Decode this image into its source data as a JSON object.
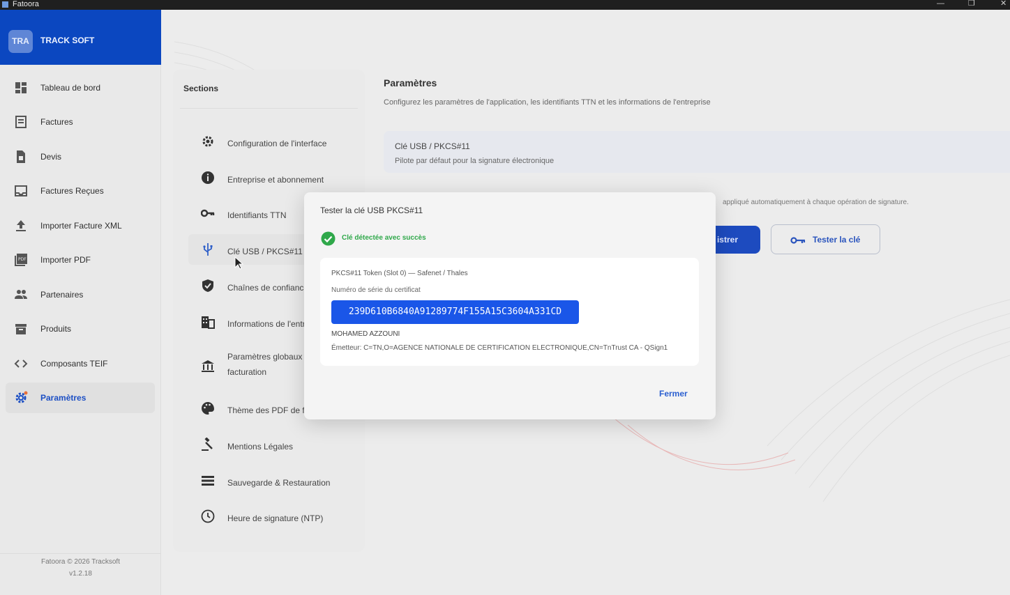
{
  "window": {
    "title": "Fatoora",
    "minimize": "—",
    "restore": "❐",
    "close": "✕"
  },
  "brand": {
    "logo": "TRA",
    "name": "TRACK SOFT"
  },
  "sidebar": {
    "items": [
      {
        "label": "Tableau de bord",
        "icon": "dashboard-icon"
      },
      {
        "label": "Factures",
        "icon": "invoice-icon"
      },
      {
        "label": "Devis",
        "icon": "quote-icon"
      },
      {
        "label": "Factures Reçues",
        "icon": "inbox-icon"
      },
      {
        "label": "Importer Facture XML",
        "icon": "upload-icon"
      },
      {
        "label": "Importer PDF",
        "icon": "pdf-icon"
      },
      {
        "label": "Partenaires",
        "icon": "people-icon"
      },
      {
        "label": "Produits",
        "icon": "box-icon"
      },
      {
        "label": "Composants TEIF",
        "icon": "code-icon"
      },
      {
        "label": "Paramètres",
        "icon": "gear-icon",
        "active": true
      }
    ],
    "footer_copyright": "Fatoora © 2026 Tracksoft",
    "footer_version": "v1.2.18"
  },
  "sections": {
    "heading": "Sections",
    "items": [
      {
        "label": "Configuration de l'interface",
        "icon": "gear-icon"
      },
      {
        "label": "Entreprise et abonnement",
        "icon": "info-icon"
      },
      {
        "label": "Identifiants TTN",
        "icon": "key-icon"
      },
      {
        "label": "Clé USB / PKCS#11",
        "icon": "usb-icon",
        "active": true
      },
      {
        "label": "Chaînes de confiance",
        "icon": "shield-icon"
      },
      {
        "label": "Informations de l'entreprise",
        "icon": "building-icon"
      },
      {
        "label": "Paramètres globaux de facturation",
        "icon": "bank-icon"
      },
      {
        "label": "Thème des PDF de facturation",
        "icon": "palette-icon"
      },
      {
        "label": "Mentions Légales",
        "icon": "gavel-icon"
      },
      {
        "label": "Sauvegarde & Restauration",
        "icon": "storage-icon"
      },
      {
        "label": "Heure de signature (NTP)",
        "icon": "clock-icon"
      }
    ]
  },
  "main": {
    "title": "Paramètres",
    "subtitle": "Configurez les paramètres de l'application, les identifiants TTN et les informations de l'entreprise",
    "usb_card_title": "Clé USB / PKCS#11",
    "usb_card_subtitle": "Pilote par défaut pour la signature électronique",
    "auto_note": "appliqué automatiquement à chaque opération de signature.",
    "save_button": "istrer",
    "test_button": "Tester la clé"
  },
  "modal": {
    "title": "Tester la clé USB PKCS#11",
    "success": "Clé détectée avec succès",
    "token": "PKCS#11 Token (Slot 0) — Safenet / Thales",
    "serial_label": "Numéro de série du certificat",
    "serial": "239D610B6840A91289774F155A15C3604A331CD",
    "holder": "MOHAMED AZZOUNI",
    "issuer": "Émetteur: C=TN,O=AGENCE NATIONALE DE CERTIFICATION ELECTRONIQUE,CN=TnTrust CA - QSign1",
    "close_button": "Fermer"
  },
  "colors": {
    "brand": "#0b47c0",
    "accent": "#1a56e8",
    "success": "#2fa84a"
  }
}
